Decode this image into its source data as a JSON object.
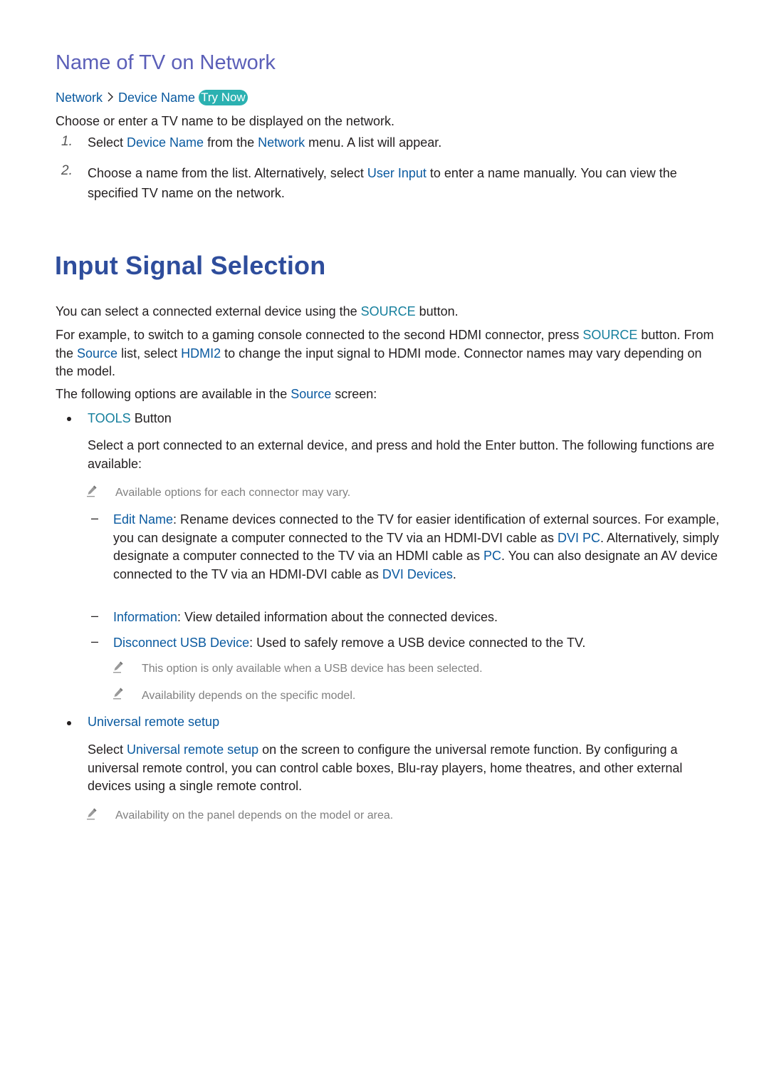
{
  "section1": {
    "title": "Name of TV on Network",
    "path": {
      "item1": "Network",
      "separator_icon": "chevron-right-icon",
      "item2": "Device Name",
      "try_now": "Try Now"
    },
    "intro": "Choose or enter a TV name to be displayed on the network.",
    "steps": [
      {
        "number": "1.",
        "parts": [
          "Select ",
          "Device Name",
          " from the ",
          "Network",
          " menu. A list will appear."
        ]
      },
      {
        "number": "2.",
        "parts": [
          "Choose a name from the list. Alternatively, select ",
          "User Input",
          " to enter a name manually. You can view the specified TV name on the network."
        ]
      }
    ]
  },
  "section2": {
    "title": "Input Signal Selection",
    "para1": [
      "You can select a connected external device using the ",
      "SOURCE",
      " button."
    ],
    "para2": [
      "For example, to switch to a gaming console connected to the second HDMI connector, press ",
      "SOURCE",
      " button. From the ",
      "Source",
      " list, select ",
      "HDMI2",
      " to change the input signal to HDMI mode. Connector names may vary depending on the model."
    ],
    "para3": [
      "The following options are available in the ",
      "Source",
      " screen:"
    ],
    "bullet1": {
      "label_highlight": "TOOLS",
      "label_rest": " Button",
      "description": "Select a port connected to an external device, and press and hold the Enter button. The following functions are available:",
      "note": "Available options for each connector may vary.",
      "subitems": [
        {
          "parts": [
            "Edit Name",
            ": Rename devices connected to the TV for easier identification of external sources. For example, you can designate a computer connected to the TV via an HDMI-DVI cable as ",
            "DVI PC",
            ". Alternatively, simply designate a computer connected to the TV via an HDMI cable as ",
            "PC",
            ". You can also designate an AV device connected to the TV via an HDMI-DVI cable as ",
            "DVI Devices",
            "."
          ]
        },
        {
          "parts": [
            "Information",
            ": View detailed information about the connected devices."
          ]
        },
        {
          "parts": [
            "Disconnect USB Device",
            ": Used to safely remove a USB device connected to the TV."
          ],
          "notes": [
            "This option is only available when a USB device has been selected.",
            "Availability depends on the specific model."
          ]
        }
      ]
    },
    "bullet2": {
      "label": "Universal remote setup",
      "description": [
        "Select ",
        "Universal remote setup",
        " on the screen to configure the universal remote function. By configuring a universal remote control, you can control cable boxes, Blu-ray players, home theatres, and other external devices using a single remote control."
      ],
      "note": "Availability on the panel depends on the model or area."
    }
  },
  "colors": {
    "heading_secondary": "#5b5fb8",
    "heading_primary": "#2e4d9c",
    "menu_link": "#0a5aa0",
    "button_name": "#157f9d",
    "try_now_bg": "#2bb1b1",
    "note_text": "#808080",
    "body_text": "#231f20"
  }
}
